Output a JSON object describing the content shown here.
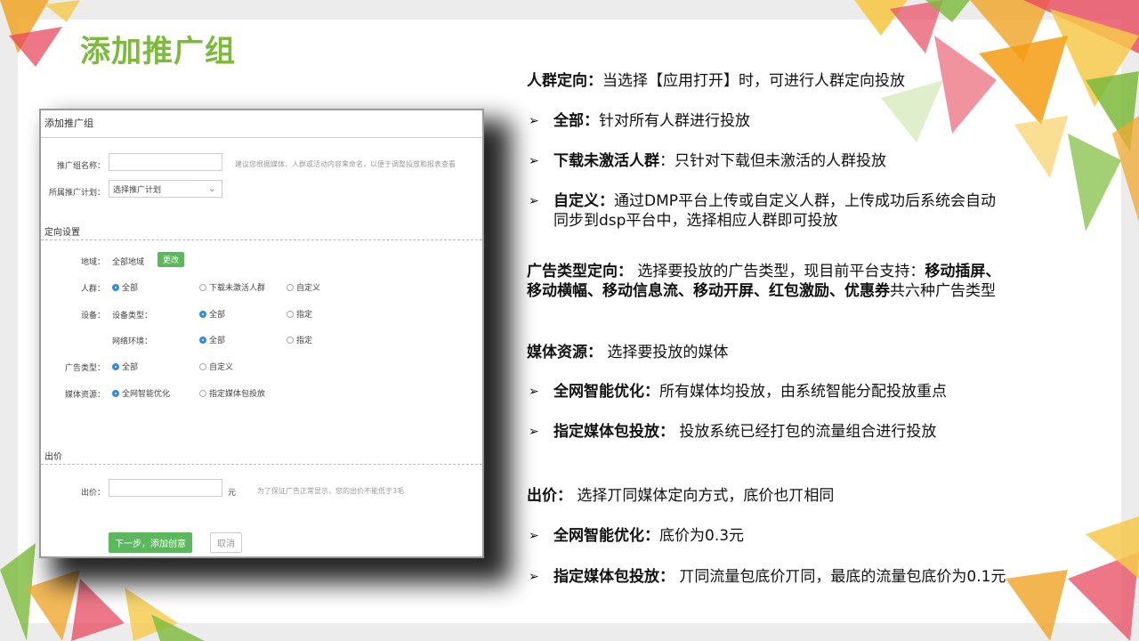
{
  "slide": {
    "title": "添加推广组"
  },
  "form": {
    "header": "添加推广组",
    "group_name_label": "推广组名称：",
    "group_name_value": "",
    "group_name_hint": "建议您根据媒体、人群或活动内容来命名，以便于调整投放和报表查看",
    "plan_label": "所属推广计划：",
    "plan_value": "选择推广计划",
    "targeting_section": "定向设置",
    "region_label": "地域：",
    "region_value": "全部地域",
    "region_button": "更改",
    "crowd_label": "人群：",
    "crowd_options": [
      "全部",
      "下载未激活人群",
      "自定义"
    ],
    "device_label": "设备：",
    "device_type_label": "设备类型：",
    "device_type_options": [
      "全部",
      "指定"
    ],
    "network_label": "网络环境：",
    "network_options": [
      "全部",
      "指定"
    ],
    "adtype_label": "广告类型：",
    "adtype_options": [
      "全部",
      "自定义"
    ],
    "media_label": "媒体资源：",
    "media_options": [
      "全网智能优化",
      "指定媒体包投放"
    ],
    "bid_section": "出价",
    "bid_label": "出价：",
    "bid_value": "",
    "bid_unit": "元",
    "bid_hint": "为了保证广告正常显示，您的出价不能低于3毛",
    "next_button": "下一步，添加创意",
    "cancel_button": "取消"
  },
  "notes": {
    "crowd_title": "人群定向：",
    "crowd_desc": "当选择【应用打开】时，可进行人群定向投放",
    "crowd_items": [
      {
        "title": "全部：",
        "desc": "针对所有人群进行投放"
      },
      {
        "title": "下载未激活人群",
        "desc": "：只针对下载但未激活的人群投放"
      },
      {
        "title": "自定义：",
        "desc": "通过DMP平台上传或自定义人群，上传成功后系统会自动",
        "desc2": "同步到dsp平台中，选择相应人群即可投放"
      }
    ],
    "adtype_title": "广告类型定向：",
    "adtype_desc": " 选择要投放的广告类型，现目前平台支持：",
    "adtype_bold1": "移动插屏、",
    "adtype_bold2": "移动横幅、移动信息流、移动开屏、红包激励、优惠券",
    "adtype_tail": "共六种广告类型",
    "media_title": "媒体资源：",
    "media_desc": " 选择要投放的媒体",
    "media_items": [
      {
        "title": "全网智能优化：",
        "desc": "所有媒体均投放，由系统智能分配投放重点"
      },
      {
        "title": "指定媒体包投放：",
        "desc": " 投放系统已经打包的流量组合进行投放"
      }
    ],
    "bid_title": "出价：",
    "bid_desc": " 选择丌同媒体定向方式，底价也丌相同",
    "bid_items": [
      {
        "title": "全网智能优化：",
        "desc": "底价为0.3元"
      },
      {
        "title": "指定媒体包投放：",
        "desc": " 丌同流量包底价丌同，最底的流量包底价为0.1元"
      }
    ],
    "bullet_glyph": "➢"
  },
  "colors": {
    "title_green": "#7cba3a",
    "button_green": "#5cb85c",
    "radio_blue": "#2d8cf0"
  }
}
